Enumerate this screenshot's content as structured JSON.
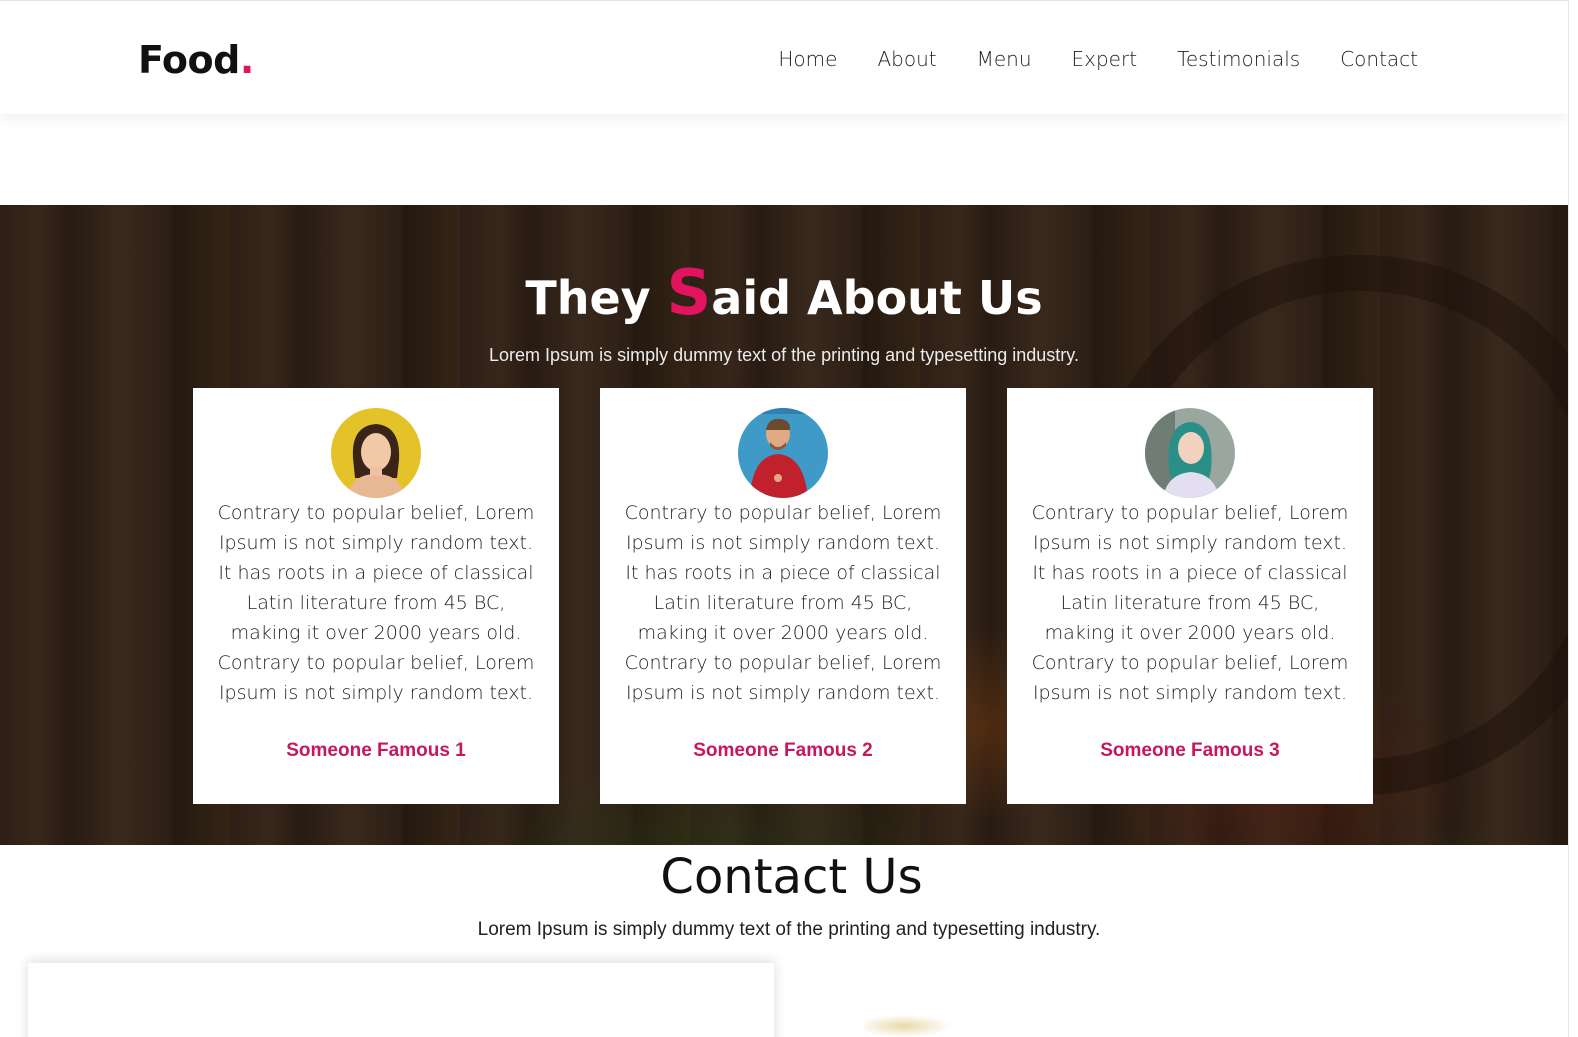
{
  "header": {
    "logo_text": "Food",
    "logo_dot": ".",
    "nav": [
      "Home",
      "About",
      "Menu",
      "Expert",
      "Testimonials",
      "Contact"
    ]
  },
  "testimonials": {
    "title_before": "They ",
    "title_big_letter": "S",
    "title_after": "aid About Us",
    "subtitle": "Lorem Ipsum is simply dummy text of the printing and typesetting industry.",
    "cards": [
      {
        "text": "Contrary to popular belief, Lorem Ipsum is not simply random text. It has roots in a piece of classical Latin literature from 45 BC, making it over 2000 years old. Contrary to popular belief, Lorem Ipsum is not simply random text.",
        "name": "Someone Famous 1"
      },
      {
        "text": "Contrary to popular belief, Lorem Ipsum is not simply random text. It has roots in a piece of classical Latin literature from 45 BC, making it over 2000 years old. Contrary to popular belief, Lorem Ipsum is not simply random text.",
        "name": "Someone Famous 2"
      },
      {
        "text": "Contrary to popular belief, Lorem Ipsum is not simply random text. It has roots in a piece of classical Latin literature from 45 BC, making it over 2000 years old. Contrary to popular belief, Lorem Ipsum is not simply random text.",
        "name": "Someone Famous 3"
      }
    ]
  },
  "contact": {
    "title": "Contact Us",
    "subtitle": "Lorem Ipsum is simply dummy text of the printing and typesetting industry."
  },
  "colors": {
    "accent": "#e2135f",
    "name_color": "#c8175c"
  }
}
